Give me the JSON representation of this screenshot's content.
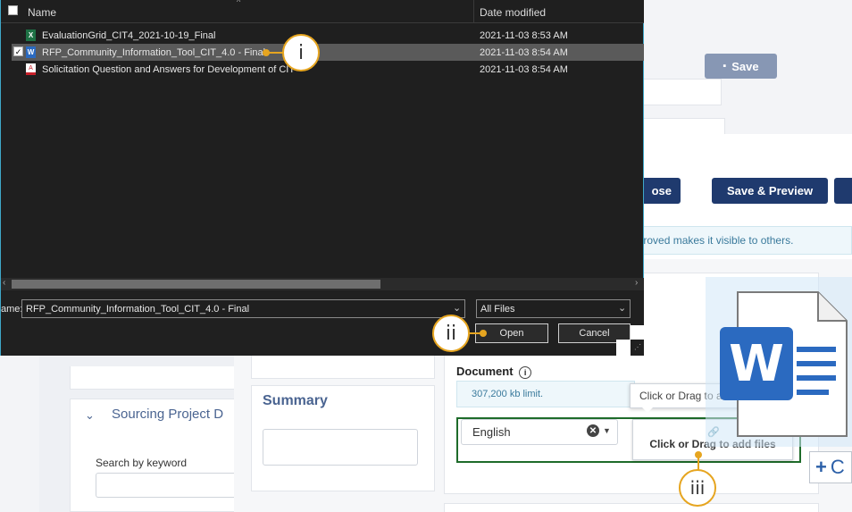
{
  "file_dialog": {
    "columns": {
      "name": "Name",
      "date_modified": "Date modified"
    },
    "files": [
      {
        "name": "EvaluationGrid_CIT4_2021-10-19_Final",
        "date": "2021-11-03 8:53 AM",
        "type": "excel"
      },
      {
        "name": "RFP_Community_Information_Tool_CIT_4.0 - Final",
        "date": "2021-11-03 8:54 AM",
        "type": "word",
        "selected": true
      },
      {
        "name": "Solicitation Question and Answers for Development of CIT",
        "date": "2021-11-03 8:54 AM",
        "type": "pdf"
      }
    ],
    "filename_label": "ame:",
    "filename_value": "RFP_Community_Information_Tool_CIT_4.0 - Final",
    "filter_value": "All Files",
    "open_label": "Open",
    "cancel_label": "Cancel"
  },
  "app": {
    "save_label": "Save",
    "close_label": "ose",
    "save_preview_label": "Save & Preview",
    "notice_text": "pproved makes it visible to others.",
    "summary_label": "Summary",
    "sourcing_label": "Sourcing Project D",
    "search_label": "Search by keyword",
    "document_label": "Document",
    "limit_text": "307,200 kb limit.",
    "language_value": "English",
    "drop_label": "Click or Drag to add files",
    "drop_ghost_label": "Click or Drag to add files",
    "add_label": "C"
  },
  "callouts": {
    "one": "i",
    "two": "ii",
    "three": "iii"
  },
  "colors": {
    "callout": "#e6a520",
    "dialog_border": "#3fa7c8",
    "highlight": "#1e6b2a",
    "primary": "#1f3a6e"
  }
}
